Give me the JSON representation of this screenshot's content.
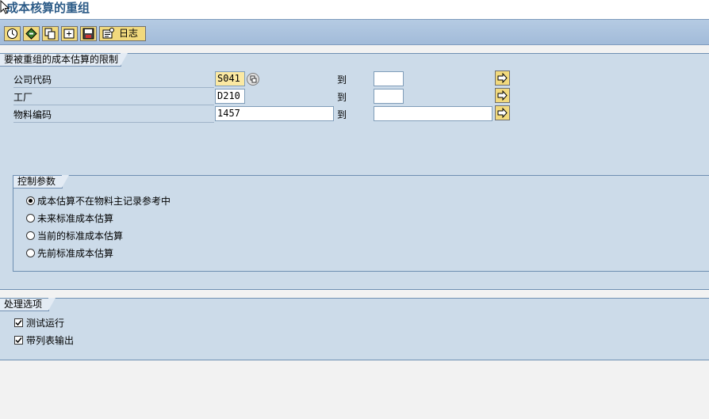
{
  "title": "成本核算的重组",
  "toolbar": {
    "buttons": [
      {
        "name": "execute-icon"
      },
      {
        "name": "variant-icon"
      },
      {
        "name": "copy-icon"
      },
      {
        "name": "select-icon"
      },
      {
        "name": "save-icon"
      }
    ],
    "log_label": "日志"
  },
  "restriction": {
    "heading": "要被重组的成本估算的限制",
    "to_label": "到",
    "rows": [
      {
        "label": "公司代码",
        "from": "S041",
        "to": ""
      },
      {
        "label": "工厂",
        "from": "D210",
        "to": ""
      },
      {
        "label": "物料编码",
        "from": "1457",
        "to": ""
      }
    ]
  },
  "control": {
    "heading": "控制参数",
    "options": [
      {
        "label": "成本估算不在物料主记录参考中",
        "selected": true
      },
      {
        "label": "未来标准成本估算",
        "selected": false
      },
      {
        "label": "当前的标准成本估算",
        "selected": false
      },
      {
        "label": "先前标准成本估算",
        "selected": false
      }
    ]
  },
  "processing": {
    "heading": "处理选项",
    "test_run": {
      "label": "测试运行",
      "checked": true
    },
    "list_output": {
      "label": "带列表输出",
      "checked": true
    }
  },
  "colors": {
    "title": "#2c5b87",
    "section": "#ccdbe9",
    "button": "#f1d97d",
    "highlight_input": "#fbe9a2"
  }
}
